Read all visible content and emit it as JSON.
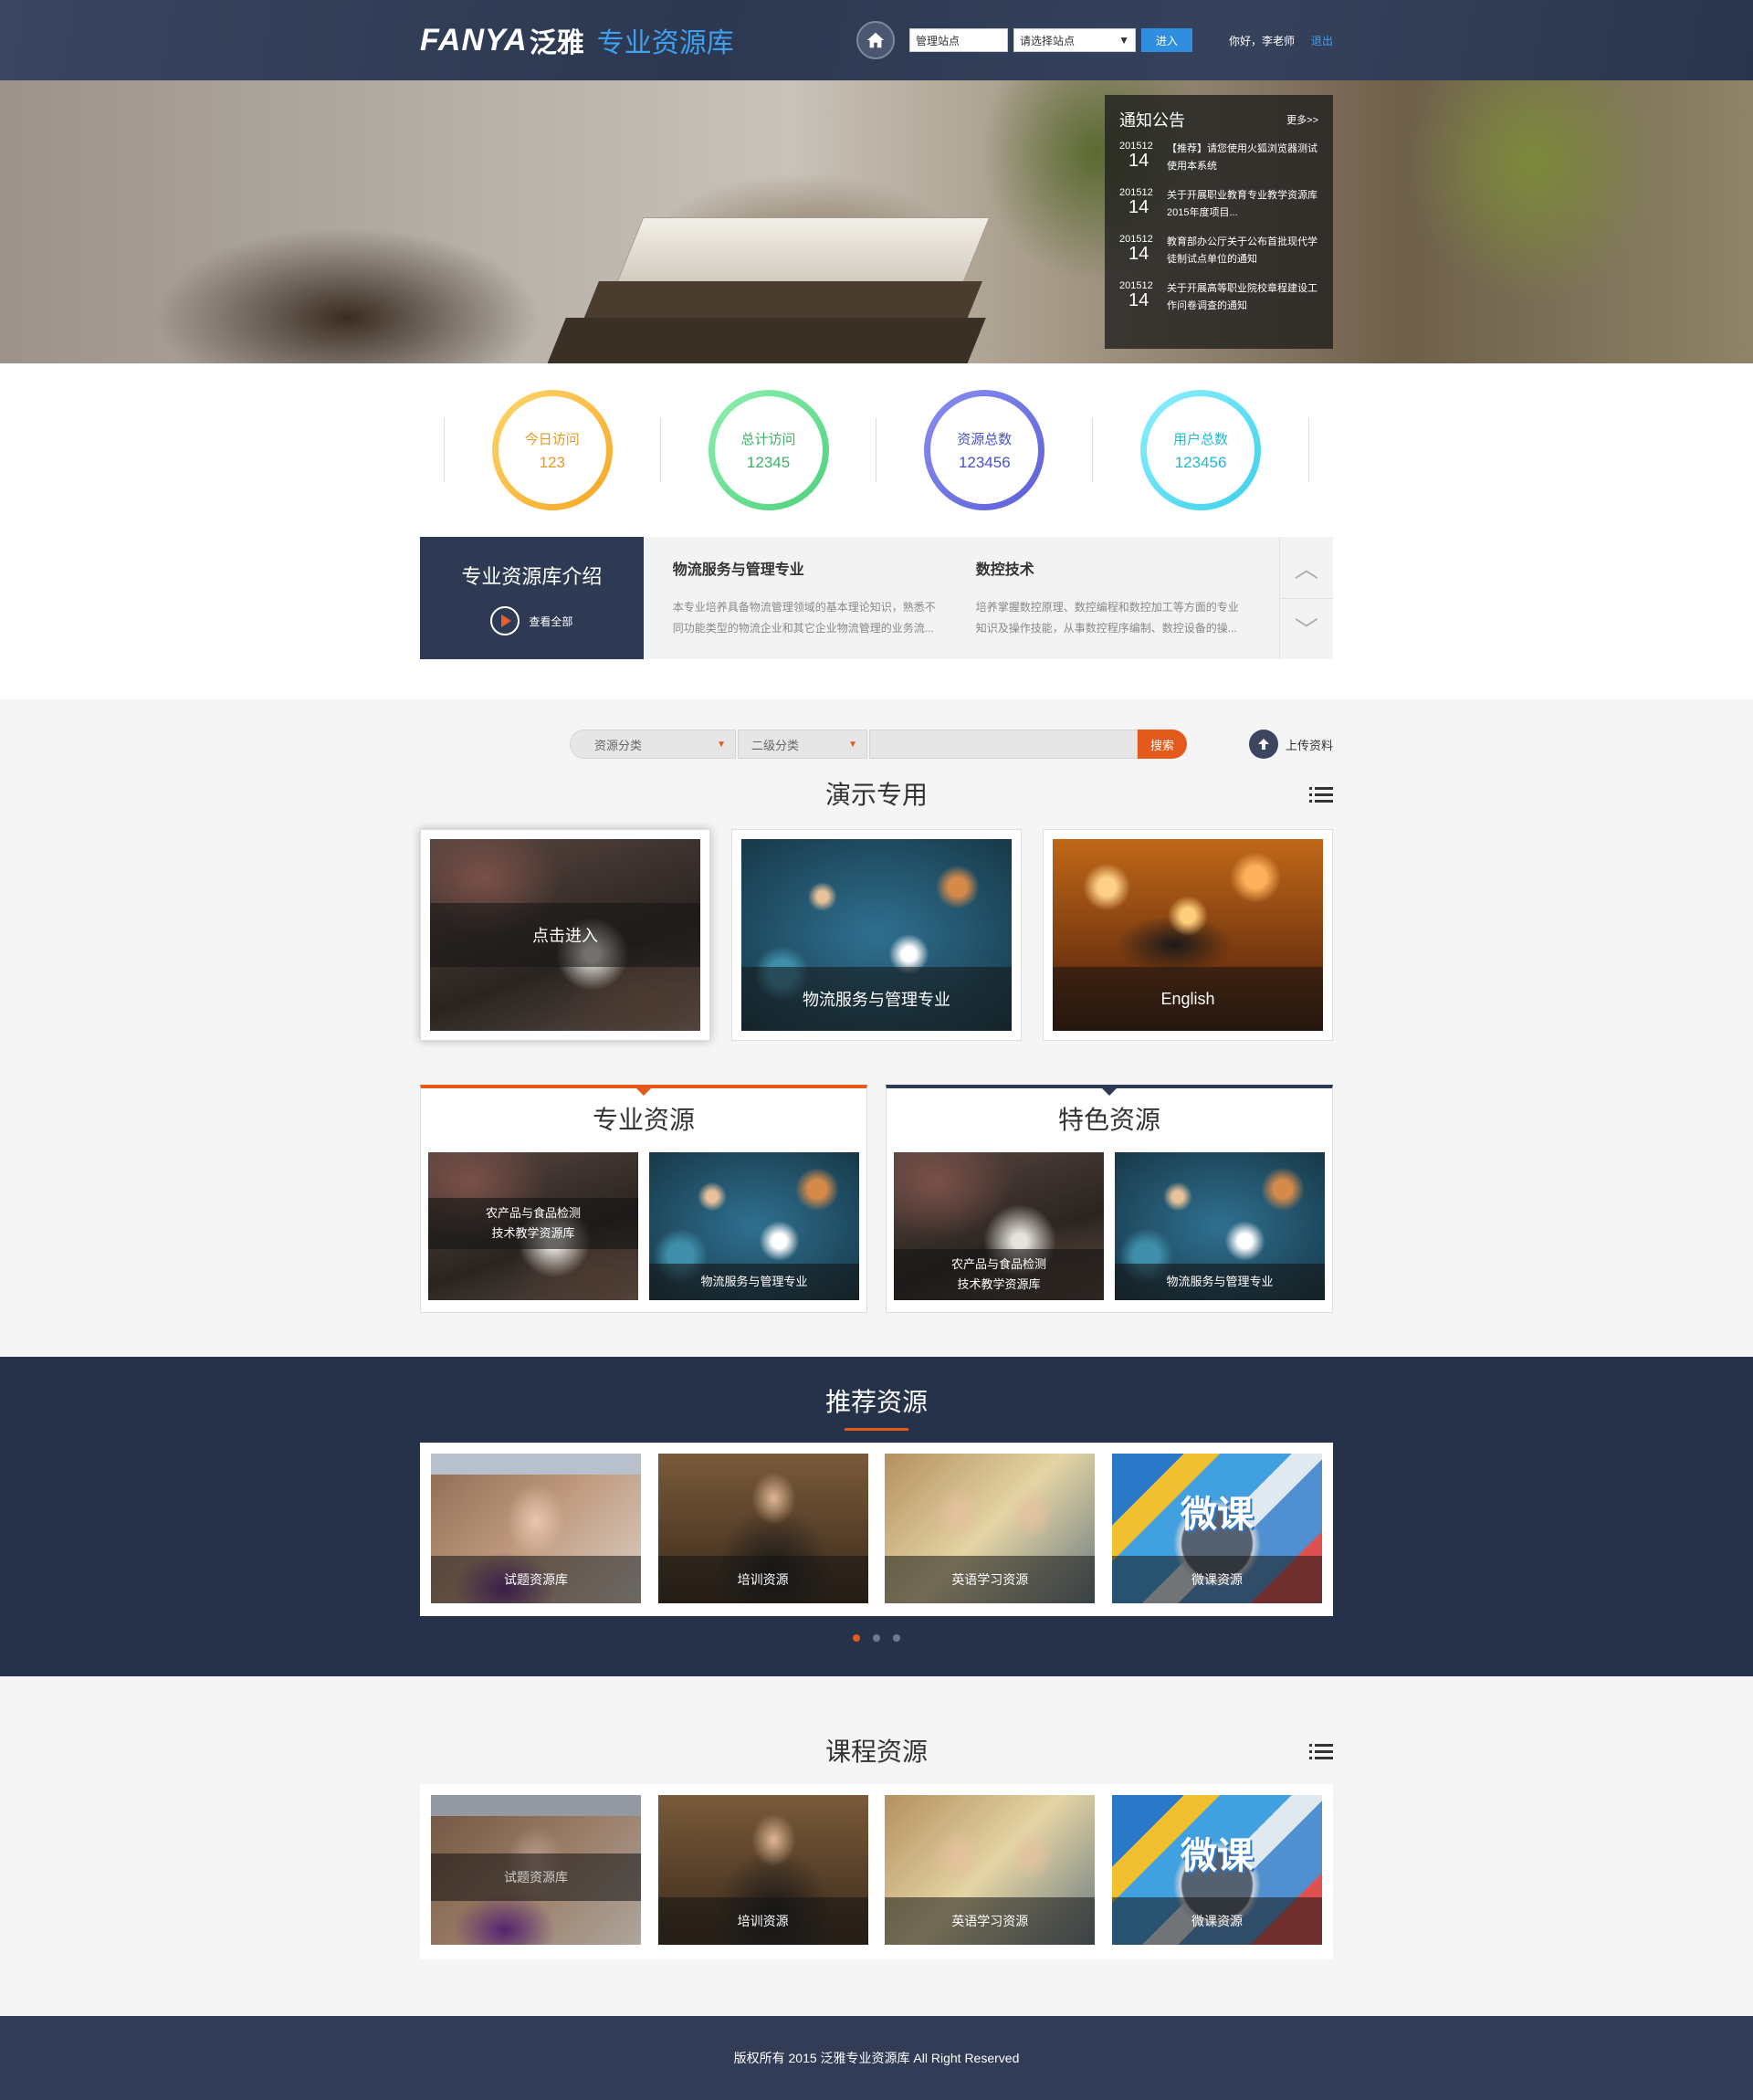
{
  "header": {
    "logo_en": "FANYA",
    "logo_cn": "泛雅",
    "logo_sub": "专业资源库",
    "site_input": "管理站点",
    "site_select": "请选择站点",
    "enter_btn": "进入",
    "user_greeting": "你好，李老师",
    "logout": "退出"
  },
  "notice": {
    "title": "通知公告",
    "more": "更多>>",
    "items": [
      {
        "ym": "201512",
        "day": "14",
        "text": "【推荐】请您使用火狐浏览器测试使用本系统"
      },
      {
        "ym": "201512",
        "day": "14",
        "text": "关于开展职业教育专业教学资源库2015年度项目..."
      },
      {
        "ym": "201512",
        "day": "14",
        "text": "教育部办公厅关于公布首批现代学徒制试点单位的通知"
      },
      {
        "ym": "201512",
        "day": "14",
        "text": "关于开展高等职业院校章程建设工作问卷调查的通知"
      }
    ]
  },
  "stats": [
    {
      "label": "今日访问",
      "value": "123",
      "color": "#f5a623"
    },
    {
      "label": "总计访问",
      "value": "12345",
      "color": "#4cd07a"
    },
    {
      "label": "资源总数",
      "value": "123456",
      "color": "#5b5fd8"
    },
    {
      "label": "用户总数",
      "value": "123456",
      "color": "#3ad0e8"
    }
  ],
  "intro": {
    "title": "专业资源库介绍",
    "view_all": "查看全部",
    "items": [
      {
        "title": "物流服务与管理专业",
        "desc": "本专业培养具备物流管理领域的基本理论知识，熟悉不同功能类型的物流企业和其它企业物流管理的业务流..."
      },
      {
        "title": "数控技术",
        "desc": "培养掌握数控原理、数控编程和数控加工等方面的专业知识及操作技能，从事数控程序编制、数控设备的操..."
      }
    ]
  },
  "search": {
    "category": "资源分类",
    "subcategory": "二级分类",
    "button": "搜索",
    "upload": "上传资料"
  },
  "demo": {
    "title": "演示专用",
    "cards": [
      "点击进入",
      "物流服务与管理专业",
      "English"
    ]
  },
  "professional": {
    "title": "专业资源",
    "items": [
      {
        "line1": "农产品与食品检测",
        "line2": "技术教学资源库"
      },
      {
        "line1": "物流服务与管理专业",
        "line2": ""
      }
    ]
  },
  "featured": {
    "title": "特色资源",
    "items": [
      {
        "line1": "农产品与食品检测",
        "line2": "技术教学资源库"
      },
      {
        "line1": "物流服务与管理专业",
        "line2": ""
      }
    ]
  },
  "recommend": {
    "title": "推荐资源",
    "items": [
      "试题资源库",
      "培训资源",
      "英语学习资源",
      "微课资源"
    ],
    "weike": "微课"
  },
  "course": {
    "title": "课程资源",
    "items": [
      "试题资源库",
      "培训资源",
      "英语学习资源",
      "微课资源"
    ],
    "weike": "微课"
  },
  "footer": {
    "copyright": "版权所有 2015 泛雅专业资源库 All Right Reserved"
  }
}
